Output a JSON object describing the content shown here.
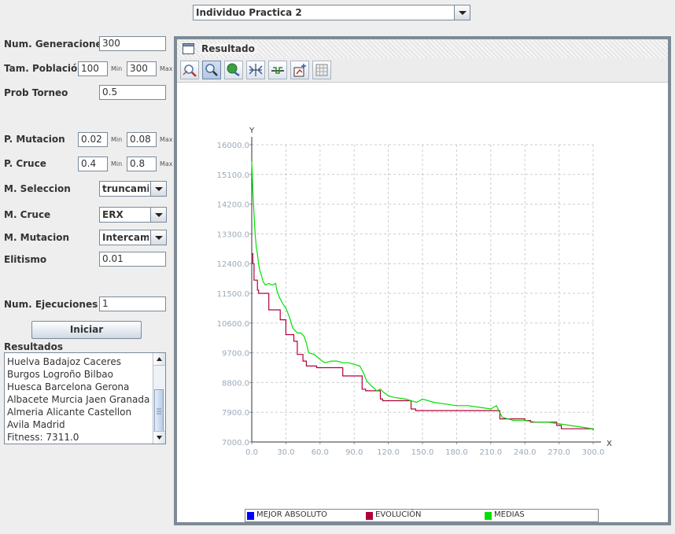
{
  "top_selector": {
    "value": "Individuo Practica 2"
  },
  "params": {
    "num_generaciones": {
      "label": "Num. Generaciones",
      "value": "300"
    },
    "tam_poblacion": {
      "label": "Tam. Población",
      "min": "100",
      "max": "300",
      "min_label": "Min",
      "max_label": "Max"
    },
    "prob_torneo": {
      "label": "Prob Torneo",
      "value": "0.5"
    },
    "p_mutacion": {
      "label": "P. Mutacion",
      "min": "0.02",
      "max": "0.08",
      "min_label": "Min",
      "max_label": "Max"
    },
    "p_cruce": {
      "label": "P. Cruce",
      "min": "0.4",
      "max": "0.8",
      "min_label": "Min",
      "max_label": "Max"
    },
    "m_seleccion": {
      "label": "M. Seleccion",
      "value": "truncami..."
    },
    "m_cruce": {
      "label": "M. Cruce",
      "value": "ERX"
    },
    "m_mutacion": {
      "label": "M. Mutacion",
      "value": "Intercam..."
    },
    "elitismo": {
      "label": "Elitismo",
      "value": "0.01"
    },
    "num_ejecuciones": {
      "label": "Num. Ejecuciones",
      "value": "1"
    }
  },
  "run_button": "Iniciar",
  "results": {
    "label": "Resultados",
    "lines": [
      "Huelva  Badajoz  Caceres",
      "Burgos  Logroño  Bilbao",
      "Huesca  Barcelona  Gerona",
      "Albacete  Murcia  Jaen  Granada",
      "Almeria  Alicante  Castellon",
      "Avila  Madrid",
      "Fitness: 7311.0"
    ]
  },
  "panel": {
    "title": "Resultado",
    "toolbar": [
      "zoom-in-icon",
      "zoom-icon",
      "pan-icon",
      "fit-icon",
      "axes-icon",
      "export-icon",
      "grid-icon"
    ]
  },
  "colors": {
    "mejor": "#0000ff",
    "evolucion": "#b0003a",
    "medias": "#00e000",
    "grid": "#cccccc",
    "axis_text": "#9aaabb"
  },
  "chart_data": {
    "type": "line",
    "xlabel": "X",
    "ylabel": "Y",
    "xlim": [
      0,
      300
    ],
    "ylim": [
      7000,
      16000
    ],
    "xticks": [
      "0.0",
      "30.0",
      "60.0",
      "90.0",
      "120.0",
      "150.0",
      "180.0",
      "210.0",
      "240.0",
      "270.0",
      "300.0"
    ],
    "yticks": [
      "7000.0",
      "7900.0",
      "8800.0",
      "9700.0",
      "10600.0",
      "11500.0",
      "12400.0",
      "13300.0",
      "14200.0",
      "15100.0",
      "16000.0"
    ],
    "legend_position": "bottom",
    "legend": [
      "MEJOR ABSOLUTO",
      "EVOLUCIÓN",
      "MEDIAS"
    ],
    "series": [
      {
        "name": "EVOLUCIÓN",
        "x": [
          0,
          1,
          2,
          5,
          6,
          14,
          15,
          20,
          25,
          30,
          37,
          40,
          45,
          48,
          55,
          57,
          60,
          65,
          80,
          97,
          100,
          113,
          115,
          140,
          144,
          215,
          218,
          240,
          245,
          268,
          272,
          300
        ],
        "y": [
          12700,
          12400,
          11900,
          11600,
          11500,
          11500,
          11000,
          11000,
          10700,
          10250,
          10050,
          9650,
          9450,
          9300,
          9300,
          9250,
          9250,
          9250,
          9000,
          8600,
          8550,
          8300,
          8250,
          8000,
          7950,
          7950,
          7700,
          7650,
          7600,
          7500,
          7400,
          7350
        ]
      },
      {
        "name": "MEDIAS",
        "x": [
          0,
          1,
          2,
          3,
          4,
          5,
          6,
          7,
          8,
          10,
          12,
          15,
          18,
          21,
          22,
          24,
          27,
          30,
          33,
          36,
          40,
          43,
          46,
          48,
          50,
          55,
          60,
          64,
          70,
          75,
          80,
          85,
          90,
          95,
          98,
          101,
          105,
          110,
          113,
          116,
          120,
          125,
          135,
          140,
          145,
          150,
          160,
          170,
          180,
          190,
          200,
          210,
          215,
          220,
          225,
          230,
          240,
          250,
          260,
          270,
          280,
          290,
          300
        ],
        "y": [
          15500,
          14600,
          13900,
          13300,
          12900,
          12700,
          12400,
          12200,
          12100,
          11850,
          11750,
          11800,
          11750,
          11800,
          11600,
          11400,
          11200,
          11050,
          10800,
          10450,
          10300,
          10300,
          10200,
          10000,
          9700,
          9650,
          9500,
          9400,
          9450,
          9450,
          9400,
          9400,
          9350,
          9300,
          9100,
          8850,
          8700,
          8550,
          8600,
          8500,
          8400,
          8350,
          8300,
          8250,
          8200,
          8300,
          8200,
          8150,
          8100,
          8100,
          8050,
          8000,
          8100,
          7750,
          7700,
          7650,
          7650,
          7600,
          7600,
          7550,
          7500,
          7450,
          7400
        ]
      }
    ]
  }
}
